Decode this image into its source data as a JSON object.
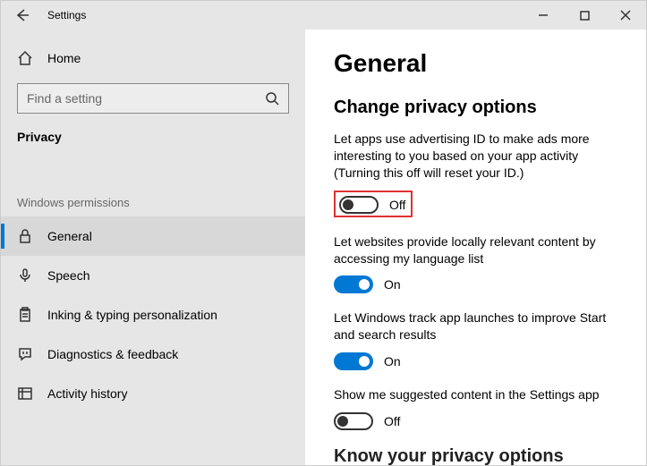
{
  "window": {
    "title": "Settings"
  },
  "sidebar": {
    "home": "Home",
    "searchPlaceholder": "Find a setting",
    "category": "Privacy",
    "groupLabel": "Windows permissions",
    "items": [
      {
        "label": "General"
      },
      {
        "label": "Speech"
      },
      {
        "label": "Inking & typing personalization"
      },
      {
        "label": "Diagnostics & feedback"
      },
      {
        "label": "Activity history"
      }
    ]
  },
  "main": {
    "title": "General",
    "sectionTitle": "Change privacy options",
    "settings": [
      {
        "desc": "Let apps use advertising ID to make ads more interesting to you based on your app activity (Turning this off will reset your ID.)",
        "state": "Off"
      },
      {
        "desc": "Let websites provide locally relevant content by accessing my language list",
        "state": "On"
      },
      {
        "desc": "Let Windows track app launches to improve Start and search results",
        "state": "On"
      },
      {
        "desc": "Show me suggested content in the Settings app",
        "state": "Off"
      }
    ],
    "cutTitle": "Know your privacy options"
  }
}
